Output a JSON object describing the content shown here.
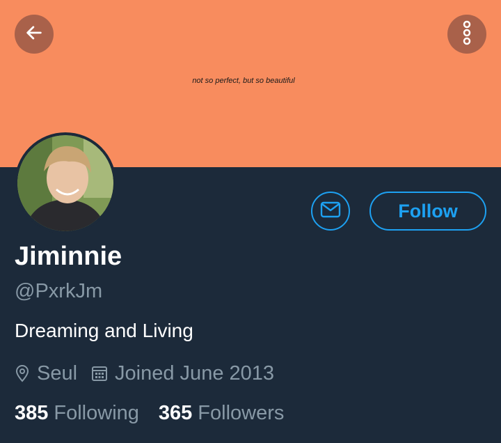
{
  "banner": {
    "caption": "not so perfect, but so beautiful",
    "color": "#f88c5e"
  },
  "header": {
    "back_icon": "arrow-left-icon",
    "more_icon": "more-vertical-icon"
  },
  "profile": {
    "display_name": "Jiminnie",
    "handle": "@PxrkJm",
    "bio": "Dreaming and Living",
    "location": "Seul",
    "joined": "Joined June 2013",
    "location_icon": "location-pin-icon",
    "calendar_icon": "calendar-icon"
  },
  "actions": {
    "message_icon": "mail-icon",
    "follow_label": "Follow"
  },
  "stats": {
    "following_count": "385",
    "following_label": "Following",
    "followers_count": "365",
    "followers_label": "Followers"
  },
  "colors": {
    "accent": "#1da1f2",
    "background": "#1c2a3a",
    "muted_text": "#8899a6"
  }
}
